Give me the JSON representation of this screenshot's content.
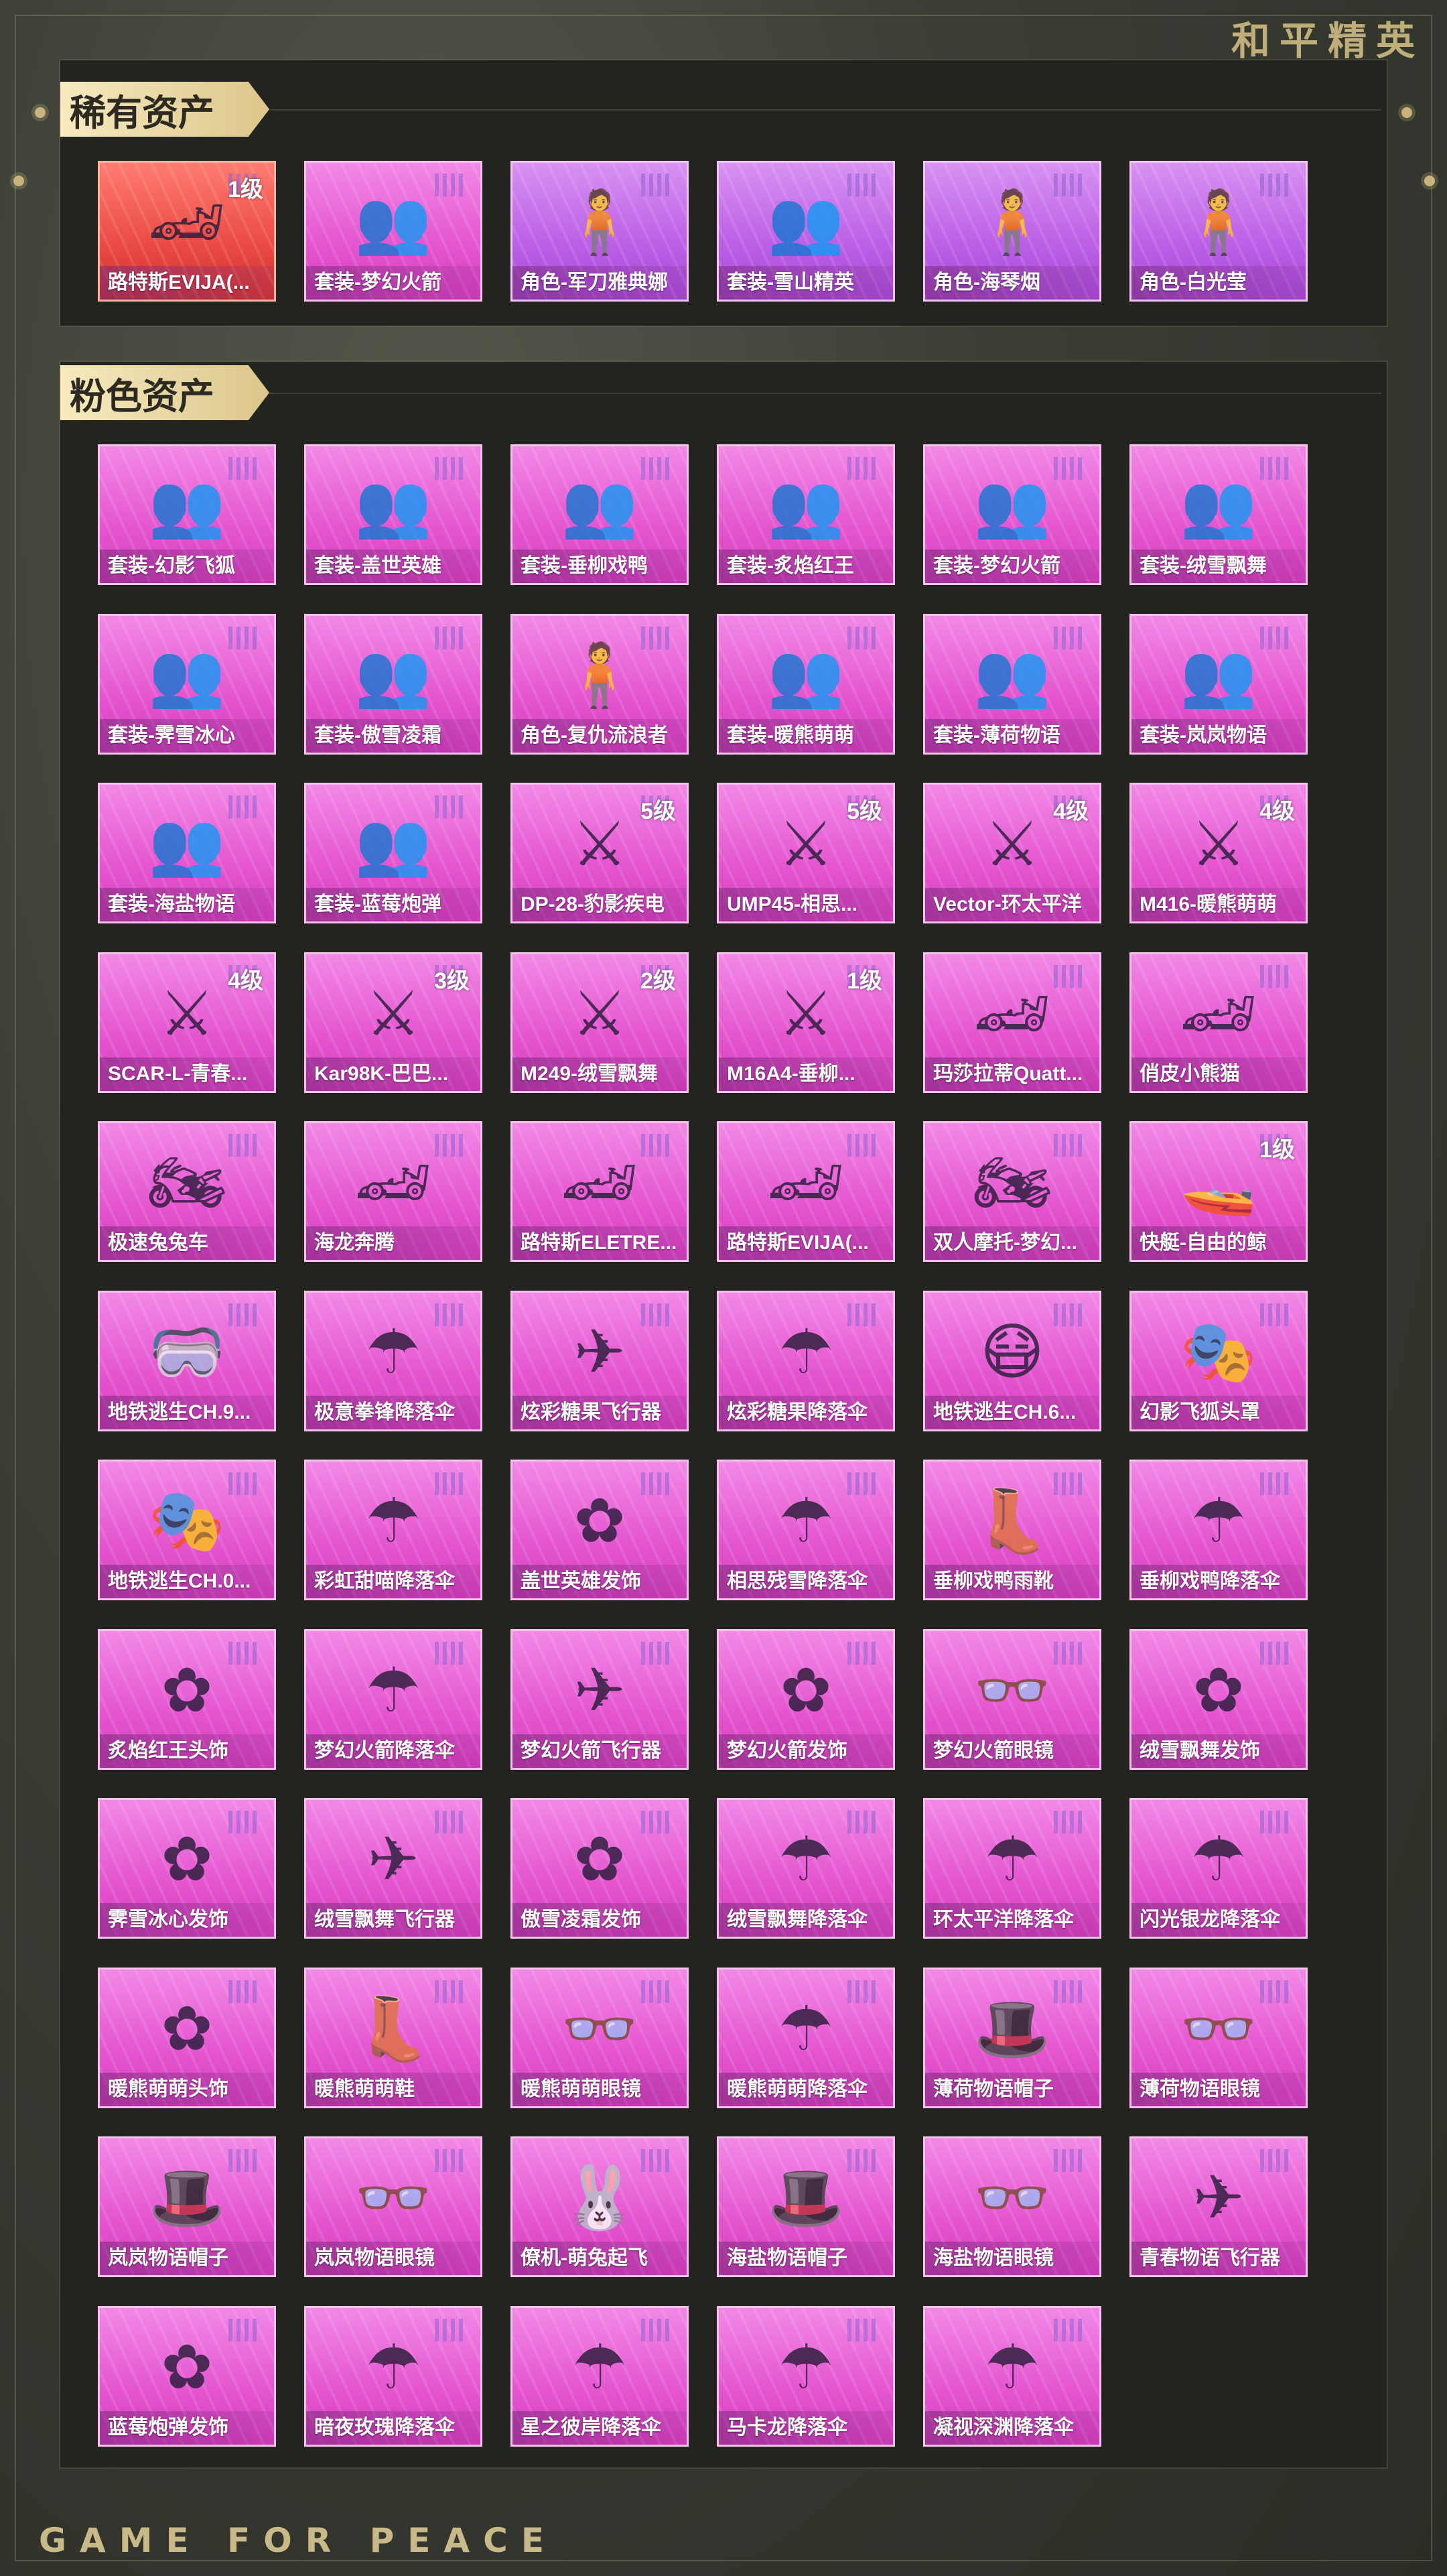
{
  "brand": {
    "top_logo": "和平精英",
    "bottom_logo": "GAME FOR PEACE"
  },
  "rare": {
    "title": "稀有资产",
    "items": [
      {
        "label": "路特斯EVIJA(...",
        "grade": "1级",
        "icon": "car-icon",
        "color": "red"
      },
      {
        "label": "套装-梦幻火箭",
        "grade": "",
        "icon": "outfit-icon",
        "color": "pink"
      },
      {
        "label": "角色-军刀雅典娜",
        "grade": "",
        "icon": "character-icon",
        "color": "purple"
      },
      {
        "label": "套装-雪山精英",
        "grade": "",
        "icon": "outfit-icon",
        "color": "purple"
      },
      {
        "label": "角色-海琴烟",
        "grade": "",
        "icon": "character-icon",
        "color": "purple"
      },
      {
        "label": "角色-白光莹",
        "grade": "",
        "icon": "character-icon",
        "color": "purple"
      }
    ]
  },
  "pink": {
    "title": "粉色资产",
    "items": [
      {
        "label": "套装-幻影飞狐",
        "grade": "",
        "icon": "outfit-icon"
      },
      {
        "label": "套装-盖世英雄",
        "grade": "",
        "icon": "outfit-icon"
      },
      {
        "label": "套装-垂柳戏鸭",
        "grade": "",
        "icon": "outfit-icon"
      },
      {
        "label": "套装-炙焰红王",
        "grade": "",
        "icon": "outfit-icon"
      },
      {
        "label": "套装-梦幻火箭",
        "grade": "",
        "icon": "outfit-icon"
      },
      {
        "label": "套装-绒雪飘舞",
        "grade": "",
        "icon": "outfit-icon"
      },
      {
        "label": "套装-霁雪冰心",
        "grade": "",
        "icon": "outfit-icon"
      },
      {
        "label": "套装-傲雪凌霜",
        "grade": "",
        "icon": "outfit-icon"
      },
      {
        "label": "角色-复仇流浪者",
        "grade": "",
        "icon": "character-icon"
      },
      {
        "label": "套装-暖熊萌萌",
        "grade": "",
        "icon": "outfit-icon"
      },
      {
        "label": "套装-薄荷物语",
        "grade": "",
        "icon": "outfit-icon"
      },
      {
        "label": "套装-岚岚物语",
        "grade": "",
        "icon": "outfit-icon"
      },
      {
        "label": "套装-海盐物语",
        "grade": "",
        "icon": "outfit-icon"
      },
      {
        "label": "套装-蓝莓炮弹",
        "grade": "",
        "icon": "outfit-icon"
      },
      {
        "label": "DP-28-豹影疾电",
        "grade": "5级",
        "icon": "gun-icon"
      },
      {
        "label": "UMP45-相思...",
        "grade": "5级",
        "icon": "gun-icon"
      },
      {
        "label": "Vector-环太平洋",
        "grade": "4级",
        "icon": "gun-icon"
      },
      {
        "label": "M416-暖熊萌萌",
        "grade": "4级",
        "icon": "gun-icon"
      },
      {
        "label": "SCAR-L-青春...",
        "grade": "4级",
        "icon": "gun-icon"
      },
      {
        "label": "Kar98K-巴巴...",
        "grade": "3级",
        "icon": "gun-icon"
      },
      {
        "label": "M249-绒雪飘舞",
        "grade": "2级",
        "icon": "gun-icon"
      },
      {
        "label": "M16A4-垂柳...",
        "grade": "1级",
        "icon": "gun-icon"
      },
      {
        "label": "玛莎拉蒂Quatt...",
        "grade": "",
        "icon": "car-icon"
      },
      {
        "label": "俏皮小熊猫",
        "grade": "",
        "icon": "car-icon"
      },
      {
        "label": "极速兔兔车",
        "grade": "",
        "icon": "motorbike-icon"
      },
      {
        "label": "海龙奔腾",
        "grade": "",
        "icon": "car-icon"
      },
      {
        "label": "路特斯ELETRE...",
        "grade": "",
        "icon": "car-icon"
      },
      {
        "label": "路特斯EVIJA(...",
        "grade": "",
        "icon": "car-icon"
      },
      {
        "label": "双人摩托-梦幻...",
        "grade": "",
        "icon": "motorbike-icon"
      },
      {
        "label": "快艇-自由的鲸",
        "grade": "1级",
        "icon": "boat-icon"
      },
      {
        "label": "地铁逃生CH.9...",
        "grade": "",
        "icon": "goggles-icon"
      },
      {
        "label": "极意拳锋降落伞",
        "grade": "",
        "icon": "parachute-icon"
      },
      {
        "label": "炫彩糖果飞行器",
        "grade": "",
        "icon": "glider-icon"
      },
      {
        "label": "炫彩糖果降落伞",
        "grade": "",
        "icon": "parachute-icon"
      },
      {
        "label": "地铁逃生CH.6...",
        "grade": "",
        "icon": "gasmask-icon"
      },
      {
        "label": "幻影飞狐头罩",
        "grade": "",
        "icon": "mask-icon"
      },
      {
        "label": "地铁逃生CH.0...",
        "grade": "",
        "icon": "mask-icon"
      },
      {
        "label": "彩虹甜喵降落伞",
        "grade": "",
        "icon": "parachute-icon"
      },
      {
        "label": "盖世英雄发饰",
        "grade": "",
        "icon": "hair-icon"
      },
      {
        "label": "相思残雪降落伞",
        "grade": "",
        "icon": "parachute-icon"
      },
      {
        "label": "垂柳戏鸭雨靴",
        "grade": "",
        "icon": "boots-icon"
      },
      {
        "label": "垂柳戏鸭降落伞",
        "grade": "",
        "icon": "parachute-icon"
      },
      {
        "label": "炙焰红王头饰",
        "grade": "",
        "icon": "hair-icon"
      },
      {
        "label": "梦幻火箭降落伞",
        "grade": "",
        "icon": "parachute-icon"
      },
      {
        "label": "梦幻火箭飞行器",
        "grade": "",
        "icon": "glider-icon"
      },
      {
        "label": "梦幻火箭发饰",
        "grade": "",
        "icon": "hair-icon"
      },
      {
        "label": "梦幻火箭眼镜",
        "grade": "",
        "icon": "glasses-icon"
      },
      {
        "label": "绒雪飘舞发饰",
        "grade": "",
        "icon": "hair-icon"
      },
      {
        "label": "霁雪冰心发饰",
        "grade": "",
        "icon": "hair-icon"
      },
      {
        "label": "绒雪飘舞飞行器",
        "grade": "",
        "icon": "glider-icon"
      },
      {
        "label": "傲雪凌霜发饰",
        "grade": "",
        "icon": "hair-icon"
      },
      {
        "label": "绒雪飘舞降落伞",
        "grade": "",
        "icon": "parachute-icon"
      },
      {
        "label": "环太平洋降落伞",
        "grade": "",
        "icon": "parachute-icon"
      },
      {
        "label": "闪光银龙降落伞",
        "grade": "",
        "icon": "parachute-icon"
      },
      {
        "label": "暖熊萌萌头饰",
        "grade": "",
        "icon": "hair-icon"
      },
      {
        "label": "暖熊萌萌鞋",
        "grade": "",
        "icon": "boots-icon"
      },
      {
        "label": "暖熊萌萌眼镜",
        "grade": "",
        "icon": "glasses-icon"
      },
      {
        "label": "暖熊萌萌降落伞",
        "grade": "",
        "icon": "parachute-icon"
      },
      {
        "label": "薄荷物语帽子",
        "grade": "",
        "icon": "hat-icon"
      },
      {
        "label": "薄荷物语眼镜",
        "grade": "",
        "icon": "glasses-icon"
      },
      {
        "label": "岚岚物语帽子",
        "grade": "",
        "icon": "hat-icon"
      },
      {
        "label": "岚岚物语眼镜",
        "grade": "",
        "icon": "glasses-icon"
      },
      {
        "label": "僚机-萌兔起飞",
        "grade": "",
        "icon": "wingman-icon"
      },
      {
        "label": "海盐物语帽子",
        "grade": "",
        "icon": "hat-icon"
      },
      {
        "label": "海盐物语眼镜",
        "grade": "",
        "icon": "glasses-icon"
      },
      {
        "label": "青春物语飞行器",
        "grade": "",
        "icon": "glider-icon"
      },
      {
        "label": "蓝莓炮弹发饰",
        "grade": "",
        "icon": "hair-icon"
      },
      {
        "label": "暗夜玫瑰降落伞",
        "grade": "",
        "icon": "parachute-icon"
      },
      {
        "label": "星之彼岸降落伞",
        "grade": "",
        "icon": "parachute-icon"
      },
      {
        "label": "马卡龙降落伞",
        "grade": "",
        "icon": "parachute-icon"
      },
      {
        "label": "凝视深渊降落伞",
        "grade": "",
        "icon": "parachute-icon"
      }
    ]
  }
}
